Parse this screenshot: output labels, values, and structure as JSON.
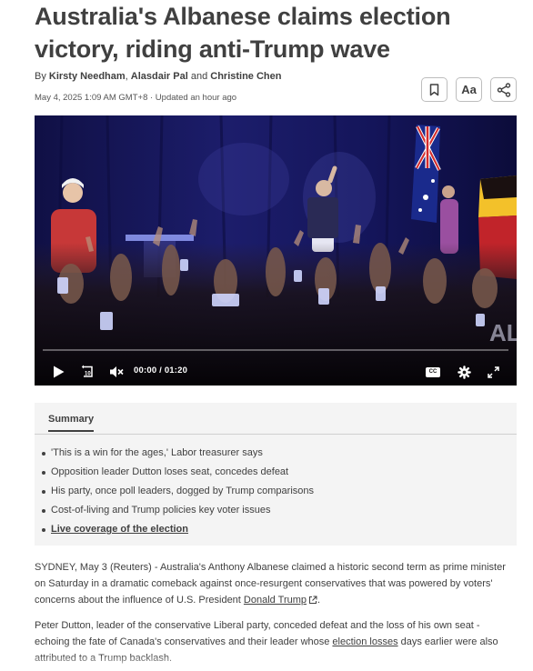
{
  "article": {
    "headline": "Australia's Albanese claims election victory, riding anti-Trump wave",
    "byline_prefix": "By ",
    "authors": [
      "Kirsty Needham",
      "Alasdair Pal",
      "Christine Chen"
    ],
    "byline_sep": ", ",
    "byline_and": " and ",
    "dateline": "May 4, 2025 1:09 AM GMT+8 · Updated an hour ago"
  },
  "tools": {
    "bookmark_icon": "bookmark-icon",
    "text_size_label": "Aa",
    "share_icon": "share-icon"
  },
  "video": {
    "timecode": "00:00 / 01:20",
    "progress": 0,
    "cc_label": "CC",
    "icons": [
      "play-icon",
      "replay-10-icon",
      "mute-icon",
      "captions-icon",
      "settings-icon",
      "fullscreen-icon"
    ]
  },
  "summary": {
    "tab_label": "Summary",
    "items": [
      {
        "text": "'This is a win for the ages,' Labor treasurer says",
        "link": false
      },
      {
        "text": "Opposition leader Dutton loses seat, concedes defeat",
        "link": false
      },
      {
        "text": "His party, once poll leaders, dogged by Trump comparisons",
        "link": false
      },
      {
        "text": "Cost-of-living and Trump policies key voter issues",
        "link": false
      },
      {
        "text": "Live coverage of the election",
        "link": true
      }
    ]
  },
  "body": {
    "p1_text": "SYDNEY, May 3 (Reuters) - Australia's Anthony Albanese claimed a historic second term as prime minister on Saturday in a dramatic comeback against once-resurgent conservatives that was powered by voters' concerns about the influence of U.S. President ",
    "p1_link": "Donald Trump",
    "p1_end": ".",
    "p2_text": "Peter Dutton, leader of the conservative Liberal party, conceded defeat and the loss of his own seat - echoing the fate of Canada's conservatives and their leader whose ",
    "p2_link": "election losses",
    "p2_end": " days earlier were also attributed to a Trump backlash."
  },
  "colors": {
    "text": "#404040",
    "summary_bg": "#f4f4f4",
    "video_bg": "#0a0a2e"
  }
}
